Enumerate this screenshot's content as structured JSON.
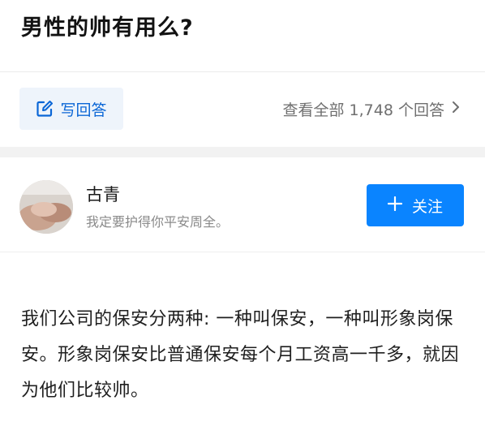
{
  "question": {
    "title": "男性的帅有用么?",
    "write_answer_label": "写回答",
    "view_all_label": "查看全部 1,748 个回答",
    "answer_count": "1,748"
  },
  "answer": {
    "author": {
      "name": "古青",
      "bio": "我定要护得你平安周全。"
    },
    "follow_label": "关注",
    "content": "我们公司的保安分两种: 一种叫保安，一种叫形象岗保安。形象岗保安比普通保安每个月工资高一千多，就因为他们比较帅。"
  },
  "colors": {
    "accent": "#0a84ff",
    "write_button_bg": "#eef4fb",
    "write_button_text": "#0a66d6",
    "band": "#f2f2f2"
  },
  "icons": {
    "write": "edit-icon",
    "view_all": "chevron-right-icon",
    "follow": "plus-icon"
  }
}
